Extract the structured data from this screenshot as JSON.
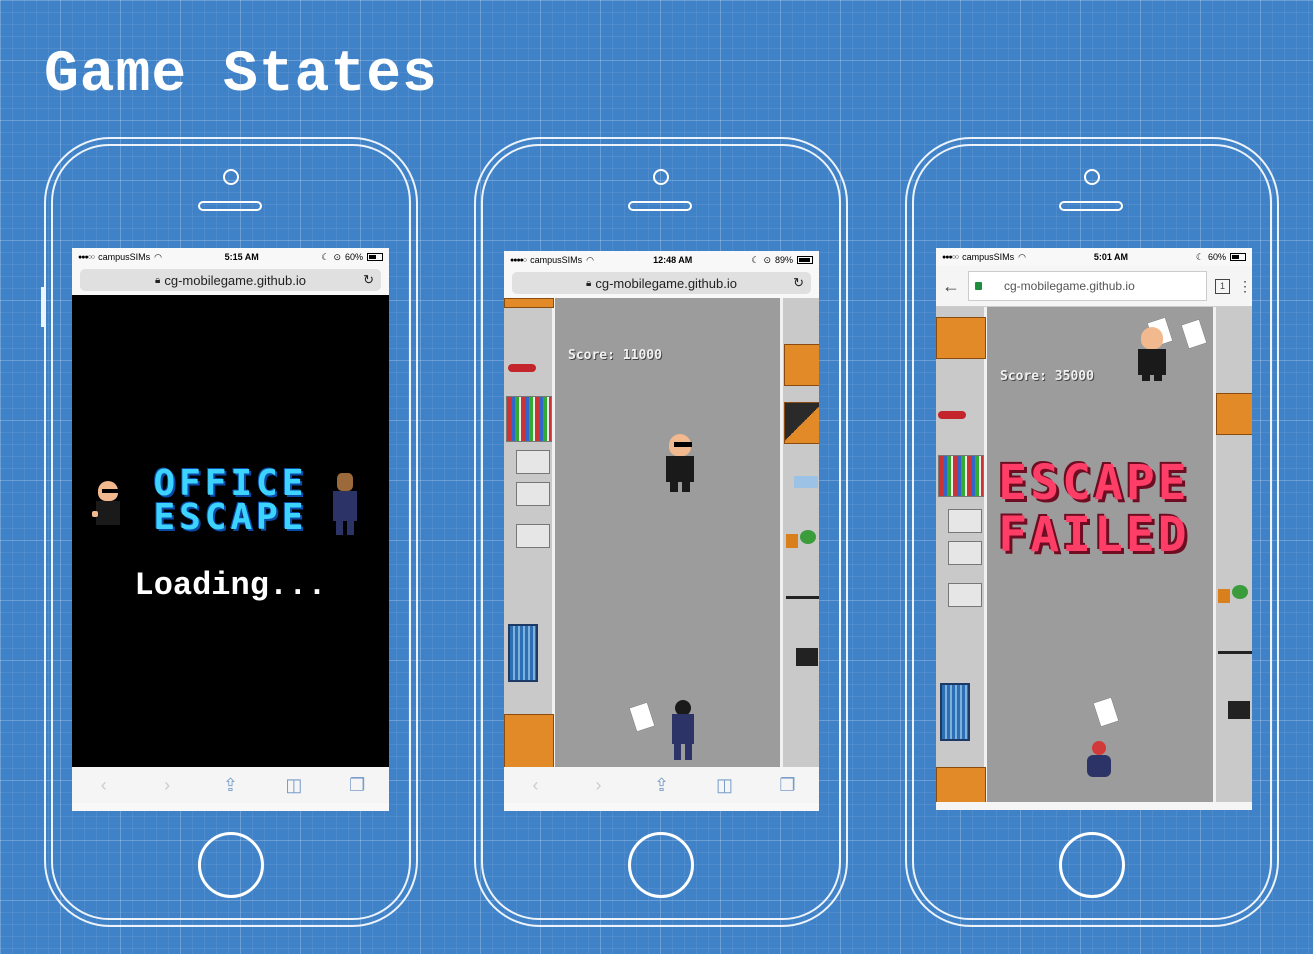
{
  "page": {
    "title": "Game States"
  },
  "phones": [
    {
      "status": {
        "carrier": "campusSIMs",
        "time": "5:15 AM",
        "battery": "60%"
      },
      "url": "cg-mobilegame.github.io",
      "game": {
        "logo_line1": "OFFICE",
        "logo_line2": "ESCAPE",
        "loading": "Loading..."
      }
    },
    {
      "status": {
        "carrier": "campusSIMs",
        "time": "12:48 AM",
        "battery": "89%"
      },
      "url": "cg-mobilegame.github.io",
      "game": {
        "score": "Score: 11000"
      }
    },
    {
      "status": {
        "carrier": "campusSIMs",
        "time": "5:01 AM",
        "battery": "60%"
      },
      "url": "cg-mobilegame.github.io",
      "tab_count": "1",
      "game": {
        "score": "Score: 35000",
        "line1": "ESCAPE",
        "line2": "FAILED"
      }
    }
  ],
  "colors": {
    "background": "#3f82c8",
    "logo": "#3dd3ff",
    "failed": "#ff3e68",
    "safari_icons": "#7a9ecb"
  },
  "icons": [
    "signal-icon",
    "wifi-icon",
    "lock-icon",
    "reload-icon",
    "back-icon",
    "forward-icon",
    "share-icon",
    "bookmarks-icon",
    "tabs-icon",
    "menu-icon",
    "moon-icon",
    "rotation-lock-icon",
    "battery-icon"
  ]
}
